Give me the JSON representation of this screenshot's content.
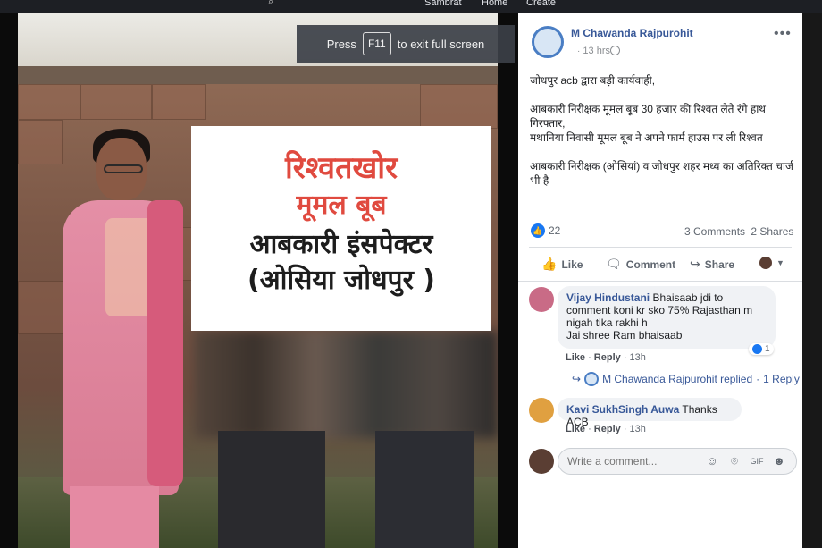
{
  "topbar": {
    "nav_items": [
      "Sambrat",
      "Home",
      "Create"
    ]
  },
  "fullscreen_hint": {
    "prefix": "Press",
    "key": "F11",
    "suffix": "to exit full screen"
  },
  "photo_card": {
    "line1": "रिश्वतखोर",
    "line2": "मूमल बूब",
    "line3": "आबकारी इंसपेक्टर",
    "line4": "(ओसिया जोधपुर )"
  },
  "post": {
    "author": "M Chawanda Rajpurohit",
    "time": "13 hrs",
    "more": "•••",
    "text_p1": "जोधपुर acb द्वारा बड़ी कार्यवाही,",
    "text_p2": "आबकारी निरीक्षक मूमल बूब 30 हजार की रिश्वत लेते रंगे हाथ गिरफ्तार,",
    "text_p3": "मथानिया निवासी मूमल बूब ने अपने फार्म हाउस पर ली रिश्वत",
    "text_p4": "आबकारी निरीक्षक (ओसियां) व जोधपुर शहर मध्य का अतिरिक्त चार्ज भी है",
    "reaction_count": "22",
    "comments_count": "3 Comments",
    "shares_count": "2 Shares"
  },
  "actions": {
    "like": "Like",
    "comment": "Comment",
    "share": "Share"
  },
  "comments": [
    {
      "name": "Vijay Hindustani",
      "text": "Bhaisaab jdi to comment koni kr sko 75% Rajasthan m nigah tika rakhi h",
      "text2": "Jai shree Ram bhaisaab",
      "like": "Like",
      "reply": "Reply",
      "time": "13h",
      "likes": "1"
    },
    {
      "name": "Kavi SukhSingh Auwa",
      "text": "Thanks ACB",
      "like": "Like",
      "reply": "Reply",
      "time": "13h"
    }
  ],
  "reply_summary": {
    "author": "M Chawanda Rajpurohit replied",
    "count": "1 Reply"
  },
  "composer": {
    "placeholder": "Write a comment..."
  },
  "colors": {
    "link": "#385898",
    "accent": "#1877f2",
    "card_red": "#e04a3f"
  }
}
